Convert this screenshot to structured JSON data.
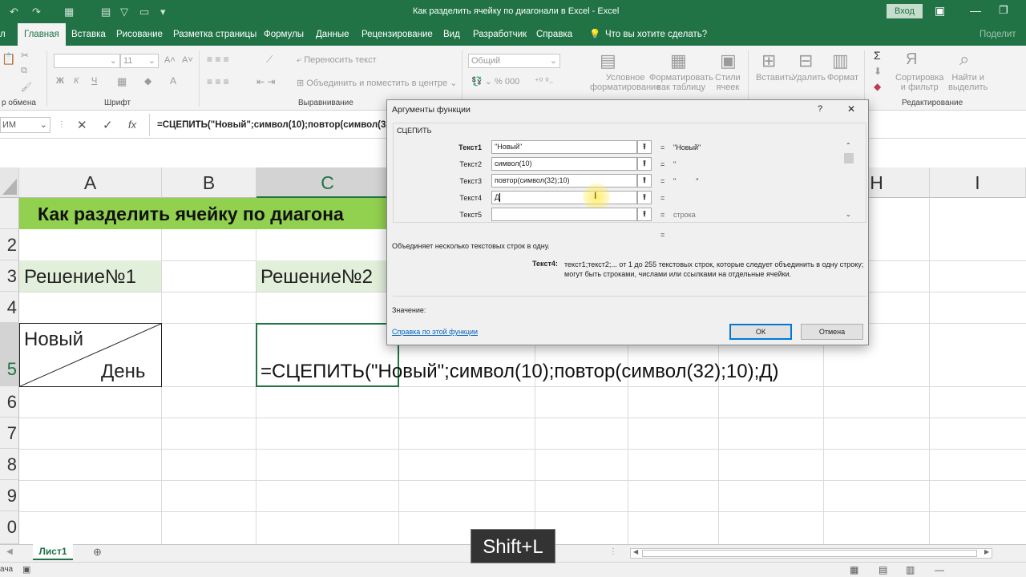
{
  "window": {
    "title": "Как разделить ячейку по диагонали в Excel  -  Excel",
    "signin": "Вход"
  },
  "tabs": [
    "Главная",
    "Вставка",
    "Рисование",
    "Разметка страницы",
    "Формулы",
    "Данные",
    "Рецензирование",
    "Вид",
    "Разработчик",
    "Справка"
  ],
  "tab_search": "Что вы хотите сделать?",
  "share": "Поделит",
  "ribbon": {
    "font_size": "11",
    "wrap_text": "Переносить текст",
    "merge_center": "Объединить и поместить в центре",
    "number_format": "Общий",
    "conditional": "Условное\nформатирование",
    "format_table": "Форматировать\nкак таблицу",
    "styles": "Стили\nячеек",
    "insert": "Вставить",
    "delete": "Удалить",
    "format": "Формат",
    "sort": "Сортировка\nи фильтр",
    "find": "Найти и\nвыделить",
    "groups": {
      "clipboard": "р обмена",
      "font": "Шрифт",
      "alignment": "Выравнивание",
      "editing": "Редактирование"
    },
    "bold": "Ж",
    "italic": "К",
    "underline": "Ч",
    "sum": "Σ",
    "sort_icon": "Я"
  },
  "formula_bar": {
    "name_box": "ИМ",
    "formula": "=СЦЕПИТЬ(\"Новый\";символ(10);повтор(символ(32);",
    "fx": "fx"
  },
  "columns": [
    "A",
    "B",
    "C",
    "H",
    "I"
  ],
  "rows": [
    "2",
    "3",
    "4",
    "5",
    "6",
    "7",
    "8",
    "9",
    "0"
  ],
  "cells": {
    "title": "Как разделить ячейку по диагона",
    "a3": "Решение№1",
    "c3": "Решение№2",
    "a5_top": "Новый",
    "a5_bottom": "День",
    "c5": "=СЦЕПИТЬ(\"Новый\";символ(10);повтор(символ(32);10);Д)"
  },
  "sheet_tab": "Лист1",
  "status_left": "ача",
  "dialog": {
    "title": "Аргументы функции",
    "help": "?",
    "close": "✕",
    "function": "СЦЕПИТЬ",
    "args": [
      {
        "label": "Текст1",
        "value": "\"Новый\"",
        "result": "\"Новый\""
      },
      {
        "label": "Текст2",
        "value": "символ(10)",
        "result": "\""
      },
      {
        "label": "Текст3",
        "value": "повтор(символ(32);10)",
        "result": "\"          \""
      },
      {
        "label": "Текст4",
        "value": "Д",
        "result": ""
      },
      {
        "label": "Текст5",
        "value": "",
        "result": "строка"
      }
    ],
    "eq": "=",
    "description": "Объединяет несколько текстовых строк в одну.",
    "arg_name": "Текст4:",
    "arg_desc": "текст1;текст2;... от 1 до 255 текстовых строк, которые следует объединить в одну строку;\nмогут быть строками, числами или ссылками на отдельные ячейки.",
    "value_label": "Значение:",
    "help_link": "Справка по этой функции",
    "ok": "ОК",
    "cancel": "Отмена"
  },
  "key_overlay": "Shift+L",
  "colors": {
    "excel_green": "#217346",
    "title_fill": "#92d050",
    "light_green": "#e2efda"
  }
}
